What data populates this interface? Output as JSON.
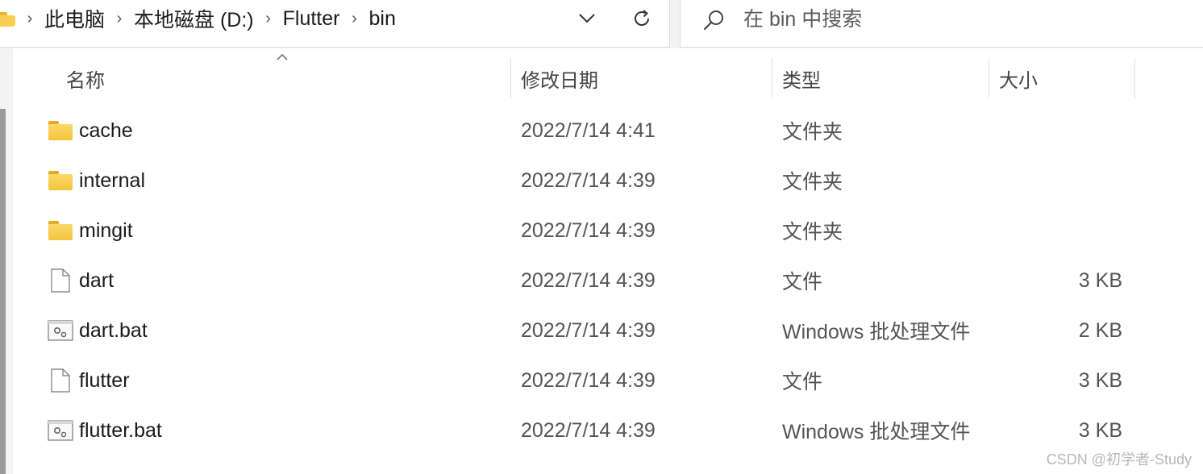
{
  "breadcrumb": {
    "items": [
      "此电脑",
      "本地磁盘 (D:)",
      "Flutter",
      "bin"
    ]
  },
  "search": {
    "placeholder": "在 bin 中搜索"
  },
  "columns": {
    "name": "名称",
    "date": "修改日期",
    "type": "类型",
    "size": "大小"
  },
  "files": [
    {
      "name": "cache",
      "date": "2022/7/14 4:41",
      "type": "文件夹",
      "size": "",
      "icon": "folder-icon"
    },
    {
      "name": "internal",
      "date": "2022/7/14 4:39",
      "type": "文件夹",
      "size": "",
      "icon": "folder-icon"
    },
    {
      "name": "mingit",
      "date": "2022/7/14 4:39",
      "type": "文件夹",
      "size": "",
      "icon": "folder-icon"
    },
    {
      "name": "dart",
      "date": "2022/7/14 4:39",
      "type": "文件",
      "size": "3 KB",
      "icon": "file-icon"
    },
    {
      "name": "dart.bat",
      "date": "2022/7/14 4:39",
      "type": "Windows 批处理文件",
      "size": "2 KB",
      "icon": "batch-file-icon"
    },
    {
      "name": "flutter",
      "date": "2022/7/14 4:39",
      "type": "文件",
      "size": "3 KB",
      "icon": "file-icon"
    },
    {
      "name": "flutter.bat",
      "date": "2022/7/14 4:39",
      "type": "Windows 批处理文件",
      "size": "3 KB",
      "icon": "batch-file-icon"
    }
  ],
  "watermark": "CSDN @初学者-Study",
  "colors": {
    "folder": "#f8cf52",
    "folder_tab": "#e5ab26",
    "chrome_bg": "#f3f3f3"
  }
}
